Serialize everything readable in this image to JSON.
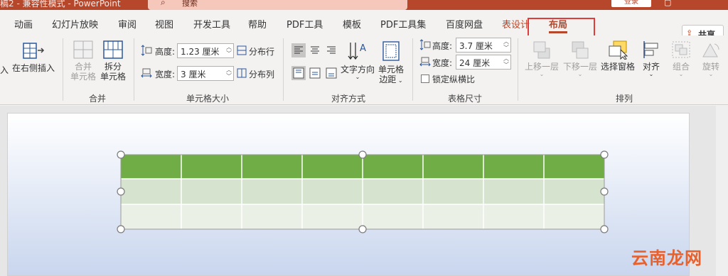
{
  "titlebar": {
    "doc_title": "稿2 - 兼容性模式 - PowerPoint",
    "search_placeholder": "搜索",
    "login": "登录"
  },
  "tabs": [
    "动画",
    "幻灯片放映",
    "审阅",
    "视图",
    "开发工具",
    "帮助",
    "PDF工具",
    "模板",
    "PDF工具集",
    "百度网盘",
    "表设计",
    "布局"
  ],
  "active_tab": "布局",
  "share": "共享",
  "ribbon": {
    "insert_left_fragment": "入",
    "insert_right": "在右侧插入",
    "merge": {
      "label": "合并",
      "merge_cells": [
        "合并",
        "单元格"
      ],
      "split_cells": [
        "拆分",
        "单元格"
      ]
    },
    "cell_size": {
      "label": "单元格大小",
      "height_label": "高度:",
      "height_value": "1.23 厘米",
      "width_label": "宽度:",
      "width_value": "3 厘米",
      "distribute_rows": "分布行",
      "distribute_cols": "分布列"
    },
    "alignment": {
      "label": "对齐方式",
      "text_direction": "文字方向",
      "cell_margins": [
        "单元格",
        "边距"
      ]
    },
    "table_size": {
      "label": "表格尺寸",
      "height_label": "高度:",
      "height_value": "3.7 厘米",
      "width_label": "宽度:",
      "width_value": "24 厘米",
      "lock_ratio": "锁定纵横比"
    },
    "arrange": {
      "label": "排列",
      "bring_forward": "上移一层",
      "send_backward": "下移一层",
      "selection_pane": "选择窗格",
      "align": "对齐",
      "group": "组合",
      "rotate": "旋转"
    }
  },
  "watermark": "云南龙网",
  "colors": {
    "accent": "#b7472a",
    "header_row": "#70ad47",
    "band_row": "#d6e3cf",
    "light_row": "#eaf0e6"
  }
}
